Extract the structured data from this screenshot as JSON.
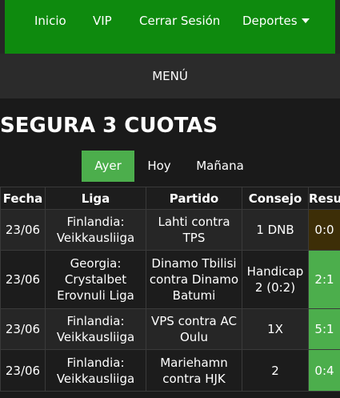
{
  "nav": {
    "items": [
      "Inicio",
      "VIP",
      "Cerrar Sesión",
      "Deportes"
    ]
  },
  "menu": {
    "label": "MENÚ"
  },
  "page": {
    "title": "SEGURA 3 CUOTAS"
  },
  "day_tabs": [
    {
      "label": "Ayer",
      "active": true
    },
    {
      "label": "Hoy",
      "active": false
    },
    {
      "label": "Mañana",
      "active": false
    }
  ],
  "table": {
    "headers": [
      "Fecha",
      "Liga",
      "Partido",
      "Consejo",
      "Resultado"
    ],
    "rows": [
      {
        "date": "23/06",
        "league": "Finlandia: Veikkausliiga",
        "match": "Lahti contra TPS",
        "tip": "1 DNB",
        "result": "0:0"
      },
      {
        "date": "23/06",
        "league": "Georgia: Crystalbet Erovnuli Liga",
        "match": "Dinamo Tbilisi contra Dinamo Batumi",
        "tip": "Handicap 2 (0:2)",
        "result": "2:1"
      },
      {
        "date": "23/06",
        "league": "Finlandia: Veikkausliiga",
        "match": "VPS contra AC Oulu",
        "tip": "1X",
        "result": "5:1"
      },
      {
        "date": "23/06",
        "league": "Finlandia: Veikkausliiga",
        "match": "Mariehamn contra HJK",
        "tip": "2",
        "result": "0:4"
      }
    ]
  },
  "colors": {
    "nav_green": "#0e8a0e",
    "active_tab": "#4cae4c",
    "win_result": "#4cae4c",
    "push_result": "#3d2e07"
  },
  "icons": {
    "dropdown": "caret-down-icon"
  }
}
